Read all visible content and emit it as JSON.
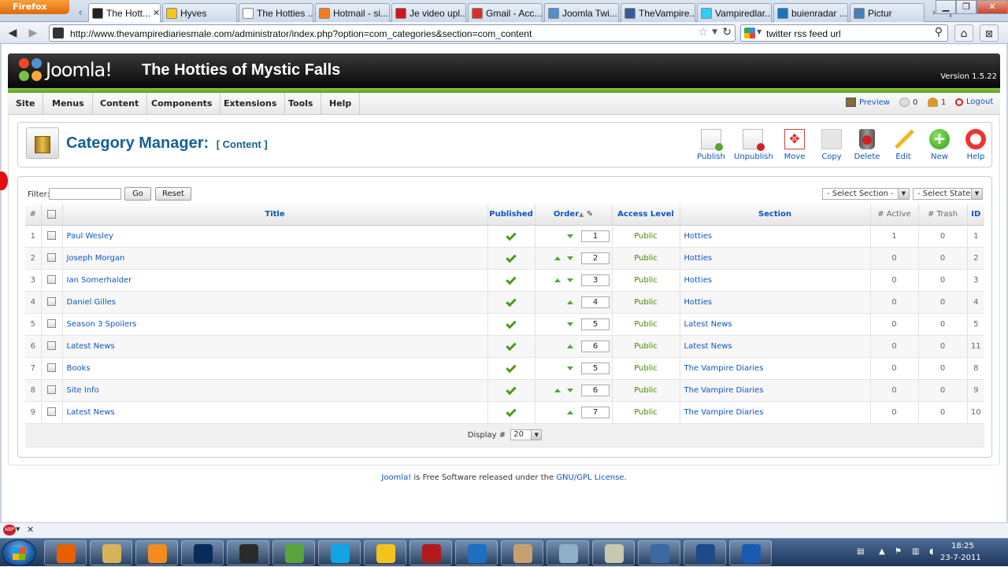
{
  "browser": {
    "menu_button": "Firefox",
    "tabs": [
      {
        "label": "The Hott...",
        "active": true,
        "color": "#222222"
      },
      {
        "label": "Hyves",
        "color": "#f5c518"
      },
      {
        "label": "The Hotties ...",
        "color": "#ffffff"
      },
      {
        "label": "Hotmail - si...",
        "color": "#f47b20"
      },
      {
        "label": "Je video upl...",
        "color": "#cc181e"
      },
      {
        "label": "Gmail - Acc...",
        "color": "#d93025"
      },
      {
        "label": "Joomla Twi...",
        "color": "#5091cd"
      },
      {
        "label": "TheVampire...",
        "color": "#3b5998"
      },
      {
        "label": "Vampiredlar...",
        "color": "#33ccff"
      },
      {
        "label": "buienradar ...",
        "color": "#1c75bc"
      },
      {
        "label": "Pictur",
        "color": "#4a7ebb"
      }
    ],
    "url": "http://www.thevampirediariesmale.com/administrator/index.php?option=com_categories&section=com_content",
    "search": "twitter rss feed url"
  },
  "header": {
    "logo_text": "Joomla!",
    "site_title": "The Hotties of Mystic Falls",
    "version": "Version 1.5.22"
  },
  "menu": {
    "items": [
      "Site",
      "Menus",
      "Content",
      "Components",
      "Extensions",
      "Tools",
      "Help"
    ],
    "preview": "Preview",
    "messages": "0",
    "users": "1",
    "logout": "Logout"
  },
  "page": {
    "title": "Category Manager:",
    "subtitle": "[ Content ]"
  },
  "toolbar": {
    "publish": "Publish",
    "unpublish": "Unpublish",
    "move": "Move",
    "copy": "Copy",
    "delete": "Delete",
    "edit": "Edit",
    "new": "New",
    "help": "Help"
  },
  "filter": {
    "label": "Filter:",
    "value": "",
    "go": "Go",
    "reset": "Reset",
    "section_select": "- Select Section -",
    "state_select": "- Select State -"
  },
  "columns": {
    "num": "#",
    "title": "Title",
    "published": "Published",
    "order": "Order",
    "access": "Access Level",
    "section": "Section",
    "active": "# Active",
    "trash": "# Trash",
    "id": "ID"
  },
  "rows": [
    {
      "num": "1",
      "title": "Paul Wesley",
      "up": false,
      "down": true,
      "order": "1",
      "access": "Public",
      "section": "Hotties",
      "active": "1",
      "trash": "0",
      "id": "1"
    },
    {
      "num": "2",
      "title": "Joseph Morgan",
      "up": true,
      "down": true,
      "order": "2",
      "access": "Public",
      "section": "Hotties",
      "active": "0",
      "trash": "0",
      "id": "2"
    },
    {
      "num": "3",
      "title": "Ian Somerhalder",
      "up": true,
      "down": true,
      "order": "3",
      "access": "Public",
      "section": "Hotties",
      "active": "0",
      "trash": "0",
      "id": "3"
    },
    {
      "num": "4",
      "title": "Daniel Gilles",
      "up": true,
      "down": false,
      "order": "4",
      "access": "Public",
      "section": "Hotties",
      "active": "0",
      "trash": "0",
      "id": "4"
    },
    {
      "num": "5",
      "title": "Season 3 Spoilers",
      "up": false,
      "down": true,
      "order": "5",
      "access": "Public",
      "section": "Latest News",
      "active": "0",
      "trash": "0",
      "id": "5"
    },
    {
      "num": "6",
      "title": "Latest News",
      "up": true,
      "down": false,
      "order": "6",
      "access": "Public",
      "section": "Latest News",
      "active": "0",
      "trash": "0",
      "id": "11"
    },
    {
      "num": "7",
      "title": "Books",
      "up": false,
      "down": true,
      "order": "5",
      "access": "Public",
      "section": "The Vampire Diaries",
      "active": "0",
      "trash": "0",
      "id": "8"
    },
    {
      "num": "8",
      "title": "Site Info",
      "up": true,
      "down": true,
      "order": "6",
      "access": "Public",
      "section": "The Vampire Diaries",
      "active": "0",
      "trash": "0",
      "id": "9"
    },
    {
      "num": "9",
      "title": "Latest News",
      "up": true,
      "down": false,
      "order": "7",
      "access": "Public",
      "section": "The Vampire Diaries",
      "active": "0",
      "trash": "0",
      "id": "10"
    }
  ],
  "pagination": {
    "label": "Display #",
    "value": "20"
  },
  "footer": {
    "link1": "Joomla!",
    "text": " is Free Software released under the ",
    "link2": "GNU/GPL License",
    "end": "."
  },
  "taskbar": {
    "apps": [
      "firefox-icon",
      "explorer-icon",
      "media-player-icon",
      "photoshop-icon",
      "terminal-icon",
      "messenger-icon",
      "skype-icon",
      "bird-icon",
      "filezilla-icon",
      "teamviewer-icon",
      "archive-icon",
      "notepad-icon",
      "paint-icon",
      "screen-icon",
      "itunes-icon",
      "app-icon"
    ],
    "time": "18:25",
    "date": "23-7-2011"
  }
}
